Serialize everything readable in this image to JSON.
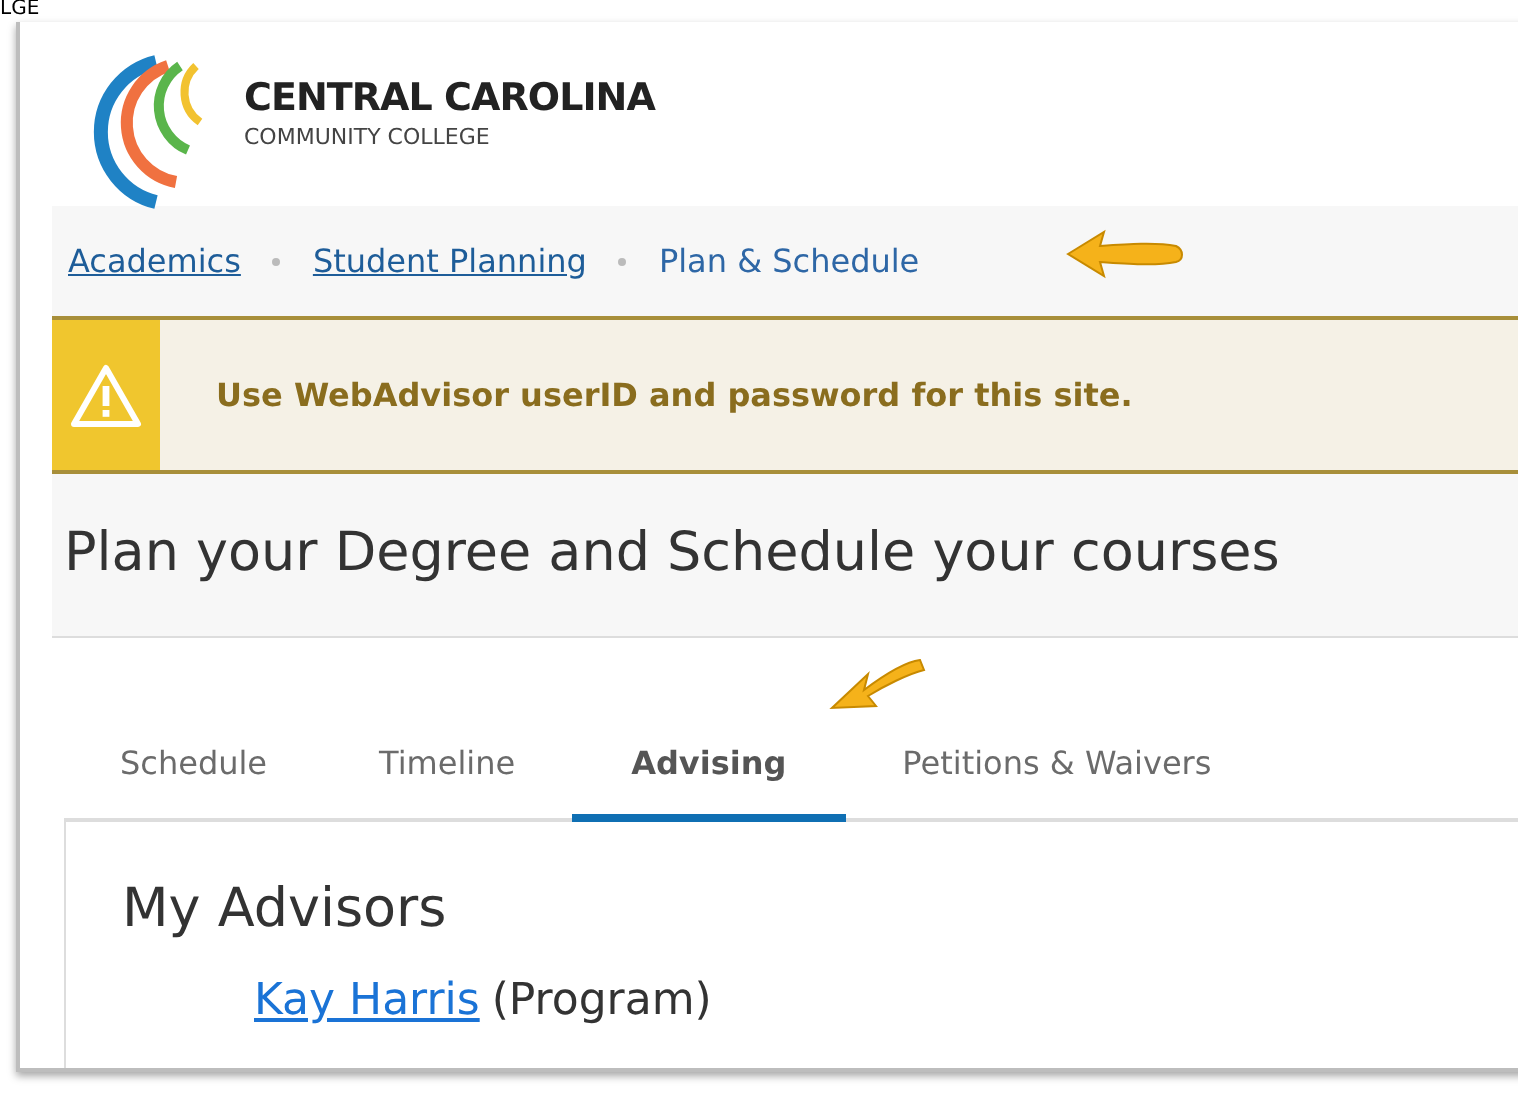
{
  "background_text": "LGE",
  "logo": {
    "title": "CENTRAL CAROLINA",
    "subtitle": "COMMUNITY COLLEGE"
  },
  "breadcrumbs": [
    {
      "label": "Academics",
      "kind": "link"
    },
    {
      "label": "Student Planning",
      "kind": "link"
    },
    {
      "label": "Plan & Schedule",
      "kind": "current"
    }
  ],
  "alert": {
    "text": "Use WebAdvisor userID and password for this site."
  },
  "heading": "Plan your Degree and Schedule your courses",
  "tabs": [
    {
      "label": "Schedule",
      "selected": false
    },
    {
      "label": "Timeline",
      "selected": false
    },
    {
      "label": "Advising",
      "selected": true
    },
    {
      "label": "Petitions & Waivers",
      "selected": false
    }
  ],
  "section": {
    "title": "My Advisors",
    "advisors": [
      {
        "name": "Kay Harris",
        "role": "(Program)"
      }
    ]
  }
}
